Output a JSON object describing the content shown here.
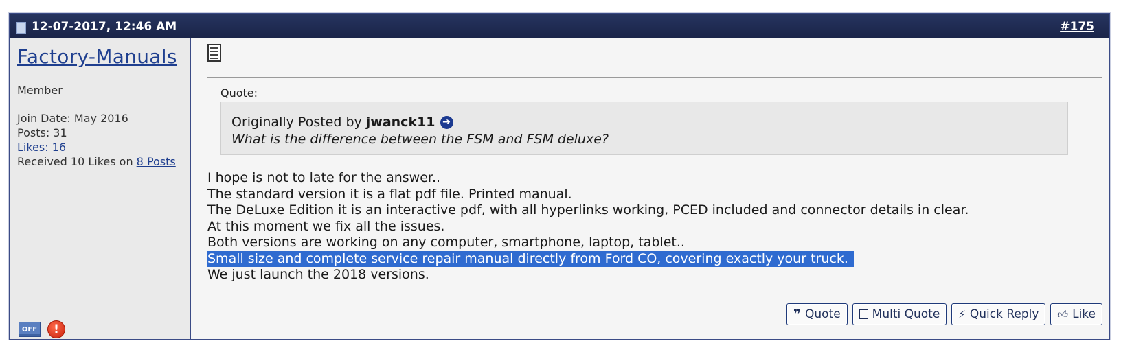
{
  "header": {
    "date": "12-07-2017, 12:46 AM",
    "post_number_prefix": "#",
    "post_number": "175"
  },
  "user": {
    "name": "Factory-Manuals",
    "title": "Member",
    "join_date": "Join Date: May 2016",
    "posts": "Posts: 31",
    "likes": "Likes: 16",
    "received_prefix": "Received 10 Likes on ",
    "received_link": "8 Posts",
    "status_badge": "OFF"
  },
  "quote": {
    "label": "Quote:",
    "originally_posted_by": "Originally Posted by",
    "author": "jwanck11",
    "text": "What is the difference between the FSM and FSM deluxe?"
  },
  "message": {
    "lines": [
      "I hope is not to late for the answer..",
      "The standard version it is a flat pdf file. Printed manual.",
      "The DeLuxe Edition it is an interactive pdf, with all hyperlinks working, PCED included and connector details in clear.",
      "At this moment we fix all the issues.",
      "Both versions are working on any computer, smartphone, laptop, tablet..",
      "Small size and complete service repair manual directly from Ford CO, covering exactly your truck.",
      "We just launch the 2018 versions."
    ]
  },
  "actions": {
    "quote": "Quote",
    "multi_quote": "Multi Quote",
    "quick_reply": "Quick Reply",
    "like": "Like"
  },
  "icons": {
    "date": "document-icon",
    "post": "post-page-icon",
    "goto": "arrow-circle-right-icon",
    "report": "exclamation-icon",
    "quote": "quote-marks-icon",
    "multi_quote": "square-icon",
    "quick_reply": "lightning-icon",
    "like": "thumbs-up-icon"
  },
  "colors": {
    "header_bg": "#1a2448",
    "link": "#1f3f8f",
    "highlight": "#2f6bd0"
  }
}
